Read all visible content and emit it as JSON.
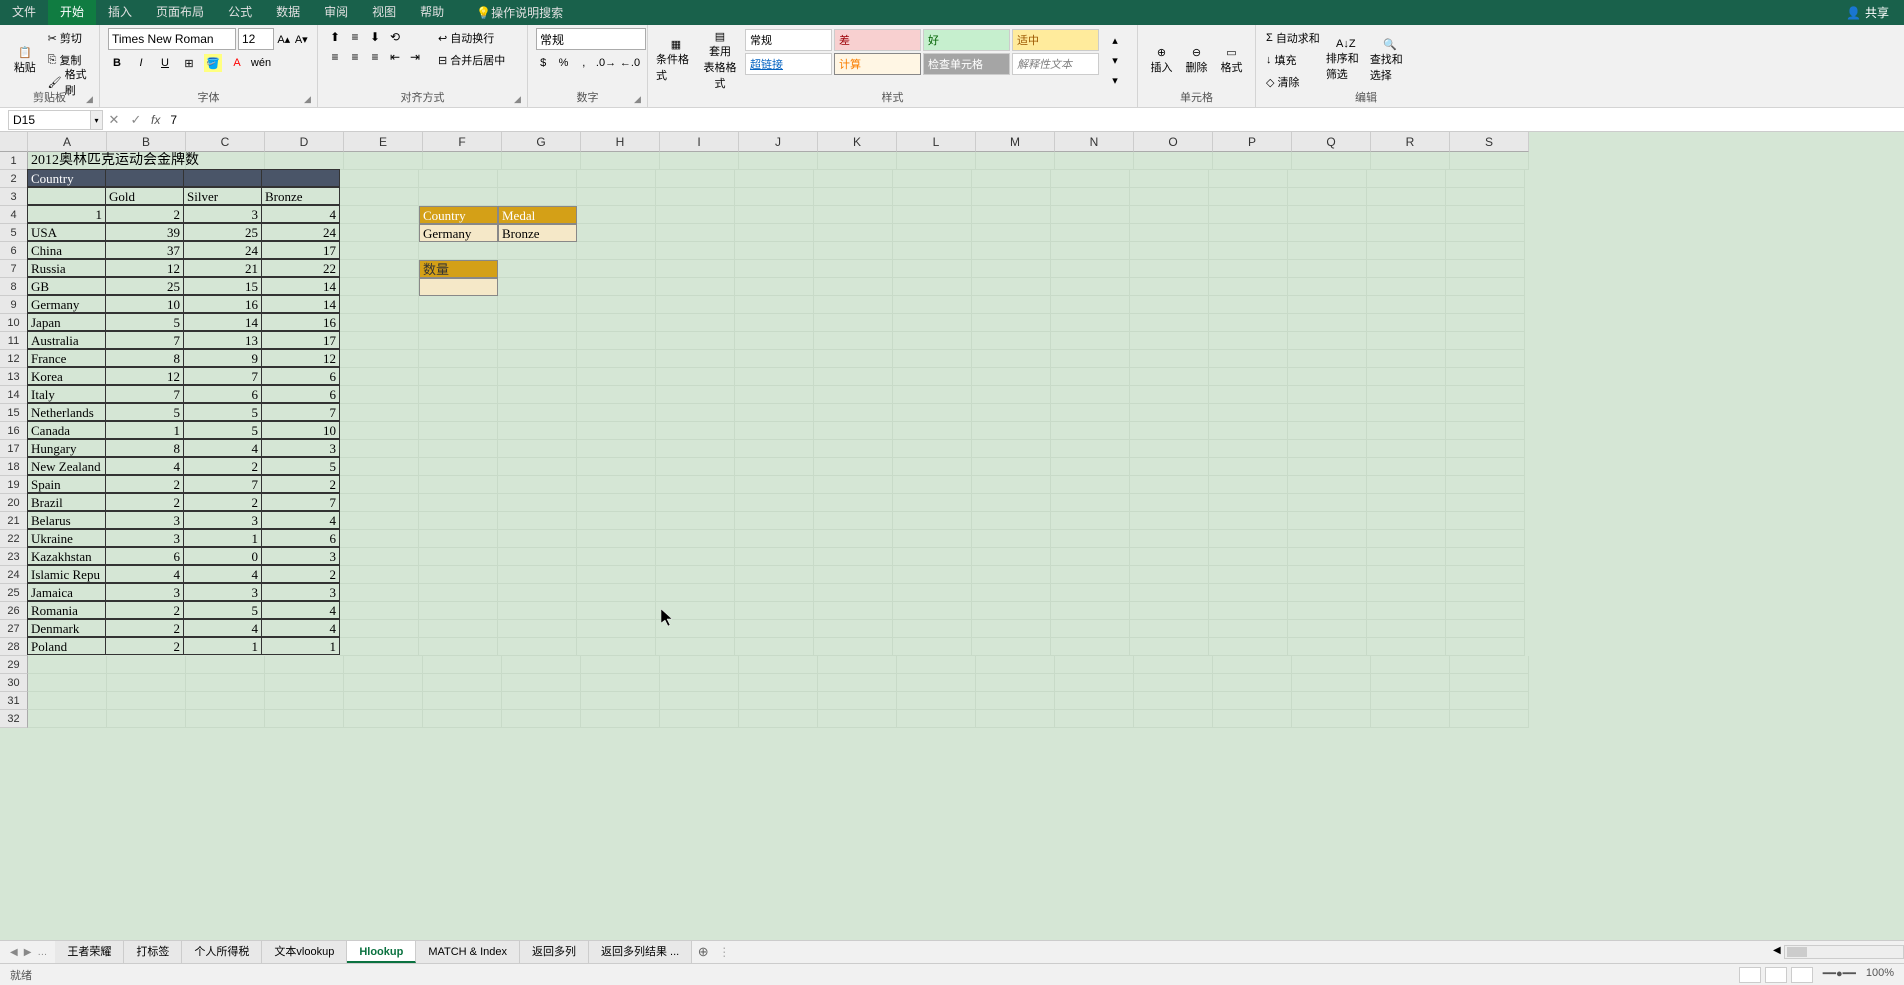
{
  "menu": {
    "file": "文件",
    "home": "开始",
    "insert": "插入",
    "layout": "页面布局",
    "formulas": "公式",
    "data": "数据",
    "review": "审阅",
    "view": "视图",
    "help": "帮助",
    "search": "操作说明搜索",
    "share": "共享"
  },
  "ribbon": {
    "clipboard": {
      "paste": "粘贴",
      "cut": "剪切",
      "copy": "复制",
      "painter": "格式刷",
      "label": "剪贴板"
    },
    "font": {
      "name": "Times New Roman",
      "size": "12",
      "label": "字体"
    },
    "align": {
      "wrap": "自动换行",
      "merge": "合并后居中",
      "label": "对齐方式"
    },
    "number": {
      "format": "常规",
      "label": "数字"
    },
    "styles": {
      "cond": "条件格式",
      "table": "套用\n表格格式",
      "normal": "常规",
      "bad": "差",
      "good": "好",
      "neutral": "适中",
      "link": "超链接",
      "calc": "计算",
      "check": "检查单元格",
      "explain": "解释性文本",
      "label": "样式"
    },
    "cells": {
      "insert": "插入",
      "delete": "删除",
      "format": "格式",
      "label": "单元格"
    },
    "editing": {
      "sum": "自动求和",
      "fill": "填充",
      "clear": "清除",
      "sort": "排序和筛选",
      "find": "查找和选择",
      "label": "编辑"
    }
  },
  "formula_bar": {
    "ref": "D15",
    "value": "7"
  },
  "columns": [
    "A",
    "B",
    "C",
    "D",
    "E",
    "F",
    "G",
    "H",
    "I",
    "J",
    "K",
    "L",
    "M",
    "N",
    "O",
    "P",
    "Q",
    "R",
    "S"
  ],
  "title_cell": "2012奥林匹克运动会金牌数",
  "header_row2": "Country",
  "medal_headers": [
    "Gold",
    "Silver",
    "Bronze"
  ],
  "index_row": [
    "1",
    "2",
    "3",
    "4"
  ],
  "data_rows": [
    [
      "USA",
      "39",
      "25",
      "24"
    ],
    [
      "China",
      "37",
      "24",
      "17"
    ],
    [
      "Russia",
      "12",
      "21",
      "22"
    ],
    [
      "GB",
      "25",
      "15",
      "14"
    ],
    [
      "Germany",
      "10",
      "16",
      "14"
    ],
    [
      "Japan",
      "5",
      "14",
      "16"
    ],
    [
      "Australia",
      "7",
      "13",
      "17"
    ],
    [
      "France",
      "8",
      "9",
      "12"
    ],
    [
      "Korea",
      "12",
      "7",
      "6"
    ],
    [
      "Italy",
      "7",
      "6",
      "6"
    ],
    [
      "Netherlands",
      "5",
      "5",
      "7"
    ],
    [
      "Canada",
      "1",
      "5",
      "10"
    ],
    [
      "Hungary",
      "8",
      "4",
      "3"
    ],
    [
      "New Zealand",
      "4",
      "2",
      "5"
    ],
    [
      "Spain",
      "2",
      "7",
      "2"
    ],
    [
      "Brazil",
      "2",
      "2",
      "7"
    ],
    [
      "Belarus",
      "3",
      "3",
      "4"
    ],
    [
      "Ukraine",
      "3",
      "1",
      "6"
    ],
    [
      "Kazakhstan",
      "6",
      "0",
      "3"
    ],
    [
      "Islamic Repu",
      "4",
      "4",
      "2"
    ],
    [
      "Jamaica",
      "3",
      "3",
      "3"
    ],
    [
      "Romania",
      "2",
      "5",
      "4"
    ],
    [
      "Denmark",
      "2",
      "4",
      "4"
    ],
    [
      "Poland",
      "2",
      "1",
      "1"
    ]
  ],
  "lookup": {
    "h1": "Country",
    "h2": "Medal",
    "v1": "Germany",
    "v2": "Bronze",
    "q_label": "数量",
    "q_value": ""
  },
  "sheets": [
    "王者荣耀",
    "打标签",
    "个人所得税",
    "文本vlookup",
    "Hlookup",
    "MATCH & Index",
    "返回多列",
    "返回多列结果 ..."
  ],
  "active_sheet": 4,
  "status": {
    "ready": "就绪",
    "zoom": "100%"
  }
}
